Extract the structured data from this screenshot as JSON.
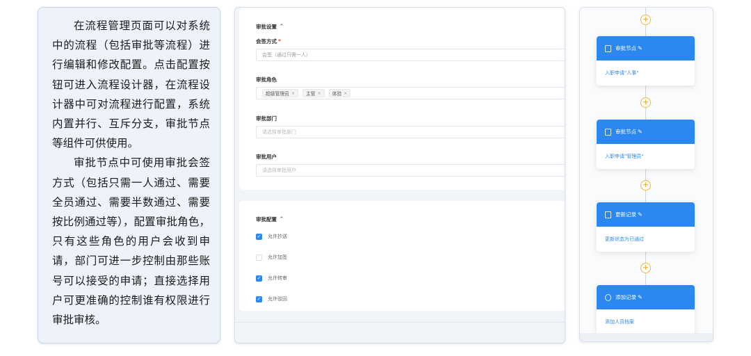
{
  "description": {
    "paragraph1": "在流程管理页面可以对系统中的流程（包括审批等流程）进行编辑和修改配置。点击配置按钮可进入流程设计器，在流程设计器中可对流程进行配置，系统内置并行、互斥分支，审批节点等组件可供使用。",
    "paragraph2": "审批节点中可使用审批会签方式（包括只需一人通过、需要全员通过、需要半数通过、需要按比例通过等），配置审批角色，只有这些角色的用户会收到申请，部门可进一步控制由那些账号可以接受的申请；直接选择用户可更准确的控制谁有权限进行审批审核。"
  },
  "approval_settings": {
    "section_title": "审批设置",
    "countersign": {
      "label": "会签方式",
      "required_mark": "*",
      "value": "会签（通过只需一人）"
    },
    "roles": {
      "label": "审批角色",
      "tags": [
        "超级管理员",
        "主管",
        "体验"
      ],
      "remove_symbol": "×"
    },
    "department": {
      "label": "审批部门",
      "placeholder": "请选择审批部门"
    },
    "user": {
      "label": "审批用户",
      "placeholder": "请选择审批用户"
    }
  },
  "approval_config": {
    "section_title": "审批配置",
    "options": [
      {
        "label": "允许抄送",
        "checked": true
      },
      {
        "label": "允许加签",
        "checked": false
      },
      {
        "label": "允许转审",
        "checked": true
      },
      {
        "label": "允许驳回",
        "checked": true
      }
    ]
  },
  "flow": {
    "nodes": [
      {
        "title": "审批节点",
        "content": "入职申请\"人事\""
      },
      {
        "title": "审批节点",
        "content": "入职申请\"管理员\""
      },
      {
        "title": "更新记录",
        "content": "更新状态为已通过"
      },
      {
        "title": "添加记录",
        "content": "添加人员档案"
      }
    ]
  },
  "colors": {
    "accent": "#2b88f0",
    "add_node": "#f2b533",
    "required": "#e54545",
    "panel_bg": "#eef3fb"
  },
  "icons": {
    "collapse": "chevron-up-icon",
    "check": "check-icon",
    "add": "plus-circle-icon",
    "edit": "edit-icon",
    "node": "document-icon"
  }
}
